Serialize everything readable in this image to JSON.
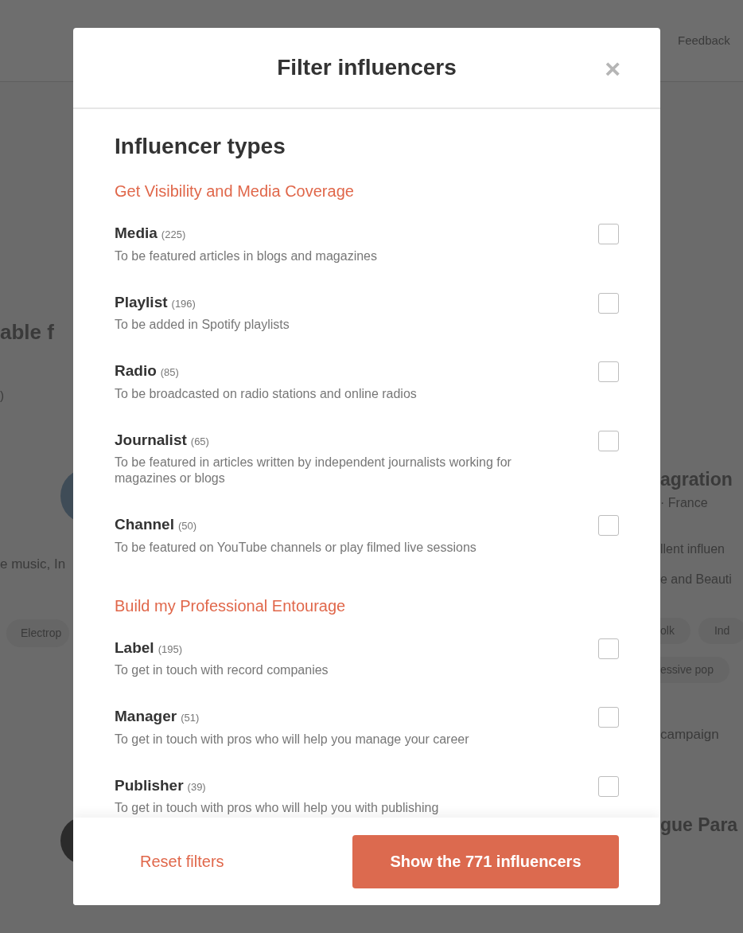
{
  "background": {
    "header_link": "Feedback",
    "left": {
      "heading": "able f",
      "count": ")",
      "genres": "e music, In",
      "chip": "Electrop"
    },
    "right": {
      "name": "agration",
      "location": "· France",
      "line_1": "llent influen",
      "line_2": "e and Beauti",
      "chips": [
        "olk",
        "Ind",
        "essive pop"
      ],
      "link": "campaign",
      "name_2": "gue Para"
    }
  },
  "modal": {
    "title": "Filter influencers",
    "close": "×",
    "heading": "Influencer types",
    "sections": [
      {
        "title": "Get Visibility and Media Coverage",
        "items": [
          {
            "name": "Media",
            "count": "(225)",
            "description": "To be featured articles in blogs and magazines",
            "checked": false
          },
          {
            "name": "Playlist",
            "count": "(196)",
            "description": "To be added in Spotify playlists",
            "checked": false
          },
          {
            "name": "Radio",
            "count": "(85)",
            "description": "To be broadcasted on radio stations and online radios",
            "checked": false
          },
          {
            "name": "Journalist",
            "count": "(65)",
            "description": "To be featured in articles written by independent journalists working for magazines or blogs",
            "checked": false
          },
          {
            "name": "Channel",
            "count": "(50)",
            "description": "To be featured on YouTube channels or play filmed live sessions",
            "checked": false
          }
        ]
      },
      {
        "title": "Build my Professional Entourage",
        "items": [
          {
            "name": "Label",
            "count": "(195)",
            "description": "To get in touch with record companies",
            "checked": false
          },
          {
            "name": "Manager",
            "count": "(51)",
            "description": "To get in touch with pros who will help you manage your career",
            "checked": false
          },
          {
            "name": "Publisher",
            "count": "(39)",
            "description": "To get in touch with pros who will help you with publishing",
            "checked": false
          }
        ]
      }
    ],
    "reset": "Reset filters",
    "submit": "Show the 771 influencers"
  }
}
